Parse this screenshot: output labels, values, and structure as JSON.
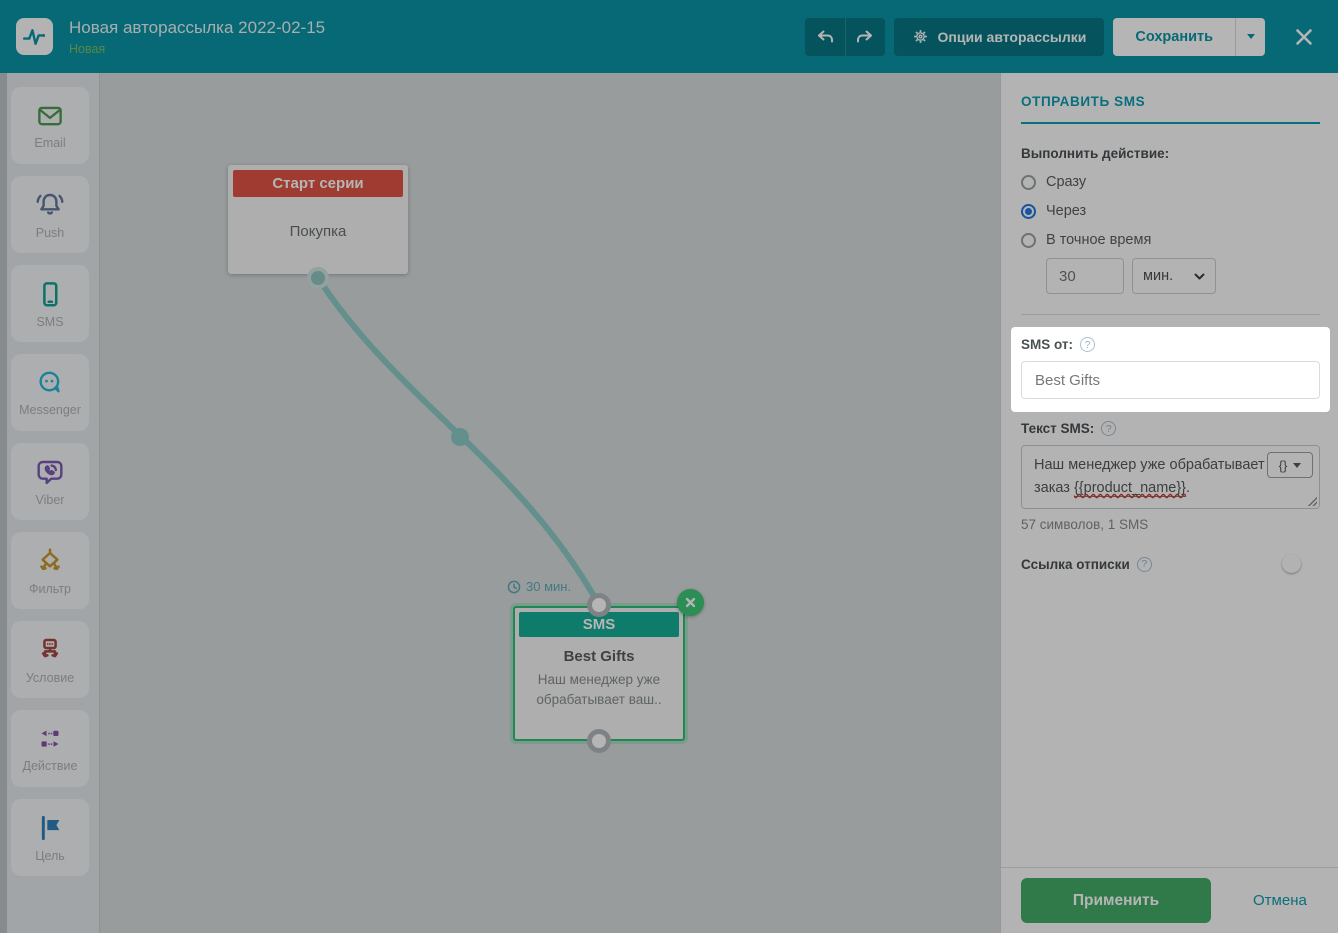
{
  "header": {
    "title": "Новая авторассылка 2022-02-15",
    "status": "Новая",
    "options_button": "Опции авторассылки",
    "save_button": "Сохранить"
  },
  "icons": {
    "help": "?"
  },
  "sidebar": {
    "items": [
      {
        "label": "Email",
        "icon": "email-envelope-icon",
        "color": "#4c9a53"
      },
      {
        "label": "Push",
        "icon": "push-bell-icon",
        "color": "#64789c"
      },
      {
        "label": "SMS",
        "icon": "sms-phone-icon",
        "color": "#12a192"
      },
      {
        "label": "Messenger",
        "icon": "messenger-bubble-icon",
        "color": "#28b6d9"
      },
      {
        "label": "Viber",
        "icon": "viber-bubble-icon",
        "color": "#7d5bb5"
      },
      {
        "label": "Фильтр",
        "icon": "filter-diamond-icon",
        "color": "#c9972e"
      },
      {
        "label": "Условие",
        "icon": "condition-branch-icon",
        "color": "#a34a42"
      },
      {
        "label": "Действие",
        "icon": "action-arrows-icon",
        "color": "#8b4fa8"
      },
      {
        "label": "Цель",
        "icon": "goal-flag-icon",
        "color": "#2f7fb8"
      }
    ]
  },
  "canvas": {
    "start_node": {
      "header": "Старт серии",
      "body": "Покупка",
      "header_color": "#e25446"
    },
    "sms_node": {
      "header": "SMS",
      "title": "Best Gifts",
      "preview": "Наш менеджер уже обрабатывает ваш..",
      "header_color": "#16ae97",
      "selection_color": "#2fbf74"
    },
    "connection_delay": "30 мин."
  },
  "panel": {
    "title": "ОТПРАВИТЬ SMS",
    "action_label": "Выполнить действие:",
    "radios": [
      {
        "label": "Сразу",
        "checked": false
      },
      {
        "label": "Через",
        "checked": true
      },
      {
        "label": "В точное время",
        "checked": false
      }
    ],
    "delay_value": "30",
    "delay_unit": "мин.",
    "sms_from": {
      "label": "SMS от:",
      "value": "Best Gifts"
    },
    "sms_text": {
      "label": "Текст SMS:",
      "before": "Наш менеджер уже обрабатывает ваш заказ ",
      "variable": "{{product_name}}",
      "after": ".",
      "insert_button": "{}",
      "counter": "57 символов, 1 SMS"
    },
    "unsubscribe": {
      "label": "Ссылка отписки",
      "enabled": false
    },
    "apply_button": "Применить",
    "cancel_button": "Отмена"
  },
  "colors": {
    "header_teal": "#0a94a6",
    "header_button_teal": "#067684",
    "accent_teal": "#0d9cb0",
    "status_green": "#7cc05e",
    "apply_green": "#44ad68",
    "radio_blue": "#2176e0",
    "start_node_red": "#e25446",
    "sms_node_green": "#16ae97",
    "selection_green": "#2fbf74",
    "connection_teal": "#8ccac5",
    "overlay": "rgba(0,0,0,0.29)"
  }
}
